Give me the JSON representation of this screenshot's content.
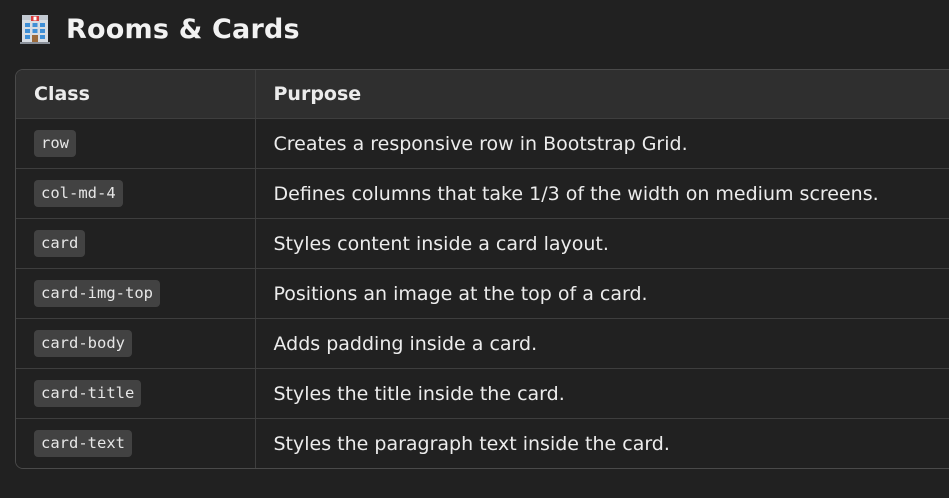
{
  "section": {
    "icon": "hotel-icon",
    "title": "Rooms & Cards"
  },
  "table": {
    "headers": [
      "Class",
      "Purpose"
    ],
    "rows": [
      {
        "class_name": "row",
        "purpose": "Creates a responsive row in Bootstrap Grid."
      },
      {
        "class_name": "col-md-4",
        "purpose": "Defines columns that take 1/3 of the width on medium screens."
      },
      {
        "class_name": "card",
        "purpose": "Styles content inside a card layout."
      },
      {
        "class_name": "card-img-top",
        "purpose": "Positions an image at the top of a card."
      },
      {
        "class_name": "card-body",
        "purpose": "Adds padding inside a card."
      },
      {
        "class_name": "card-title",
        "purpose": "Styles the title inside the card."
      },
      {
        "class_name": "card-text",
        "purpose": "Styles the paragraph text inside the card."
      }
    ]
  }
}
